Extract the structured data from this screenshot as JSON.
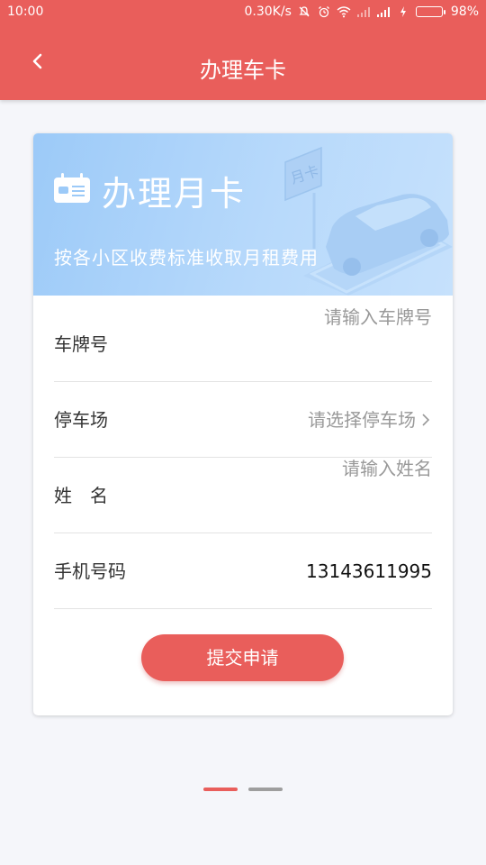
{
  "status_bar": {
    "time": "10:00",
    "speed": "0.30K/s",
    "battery_percent": "98%",
    "battery_level": 0.98,
    "icons": [
      "mute-icon",
      "alarm-icon",
      "wifi-icon",
      "signal-icon",
      "signal-icon",
      "charging-icon"
    ]
  },
  "header": {
    "title": "办理车卡",
    "back_icon": "chevron-left-icon"
  },
  "banner": {
    "icon": "card-icon",
    "title": "办理月卡",
    "subtitle": "按各小区收费标准收取月租费用",
    "sign_text": "月卡"
  },
  "form": {
    "plate": {
      "label": "车牌号",
      "placeholder": "请输入车牌号"
    },
    "parking": {
      "label": "停车场",
      "placeholder": "请选择停车场",
      "chevron": "chevron-right-icon"
    },
    "name": {
      "label": "姓　名",
      "placeholder": "请输入姓名"
    },
    "phone": {
      "label": "手机号码",
      "value": "13143611995"
    }
  },
  "submit_label": "提交申请",
  "pager": {
    "count": 2,
    "active": 0
  },
  "colors": {
    "primary": "#e95e5b",
    "banner_light": "#c6e1fc",
    "banner_dark": "#9ccaf8",
    "pager_active": "#e95e5b",
    "pager_inactive": "#9e9e9e"
  }
}
